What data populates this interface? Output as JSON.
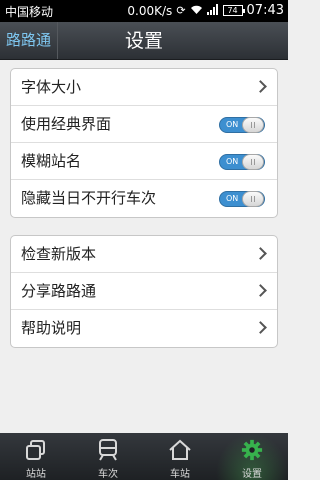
{
  "status_bar": {
    "carrier": "中国移动",
    "speed": "0.00K/s",
    "battery": "74",
    "time": "07:43"
  },
  "header": {
    "app_name": "路路通",
    "title": "设置"
  },
  "settings": {
    "group1": [
      {
        "label": "字体大小",
        "control": "chevron"
      },
      {
        "label": "使用经典界面",
        "control": "toggle",
        "state": "ON"
      },
      {
        "label": "模糊站名",
        "control": "toggle",
        "state": "ON"
      },
      {
        "label": "隐藏当日不开行车次",
        "control": "toggle",
        "state": "ON"
      }
    ],
    "group2": [
      {
        "label": "检查新版本",
        "control": "chevron"
      },
      {
        "label": "分享路路通",
        "control": "chevron"
      },
      {
        "label": "帮助说明",
        "control": "chevron"
      }
    ]
  },
  "bottom_nav": {
    "items": [
      {
        "label": "站站",
        "icon": "station-to-station-icon"
      },
      {
        "label": "车次",
        "icon": "train-icon"
      },
      {
        "label": "车站",
        "icon": "home-station-icon"
      },
      {
        "label": "设置",
        "icon": "gear-icon",
        "active": true
      }
    ]
  },
  "colors": {
    "accent": "#3d8fd0",
    "app_name": "#7ec6ef",
    "active_nav": "#37b24d"
  }
}
